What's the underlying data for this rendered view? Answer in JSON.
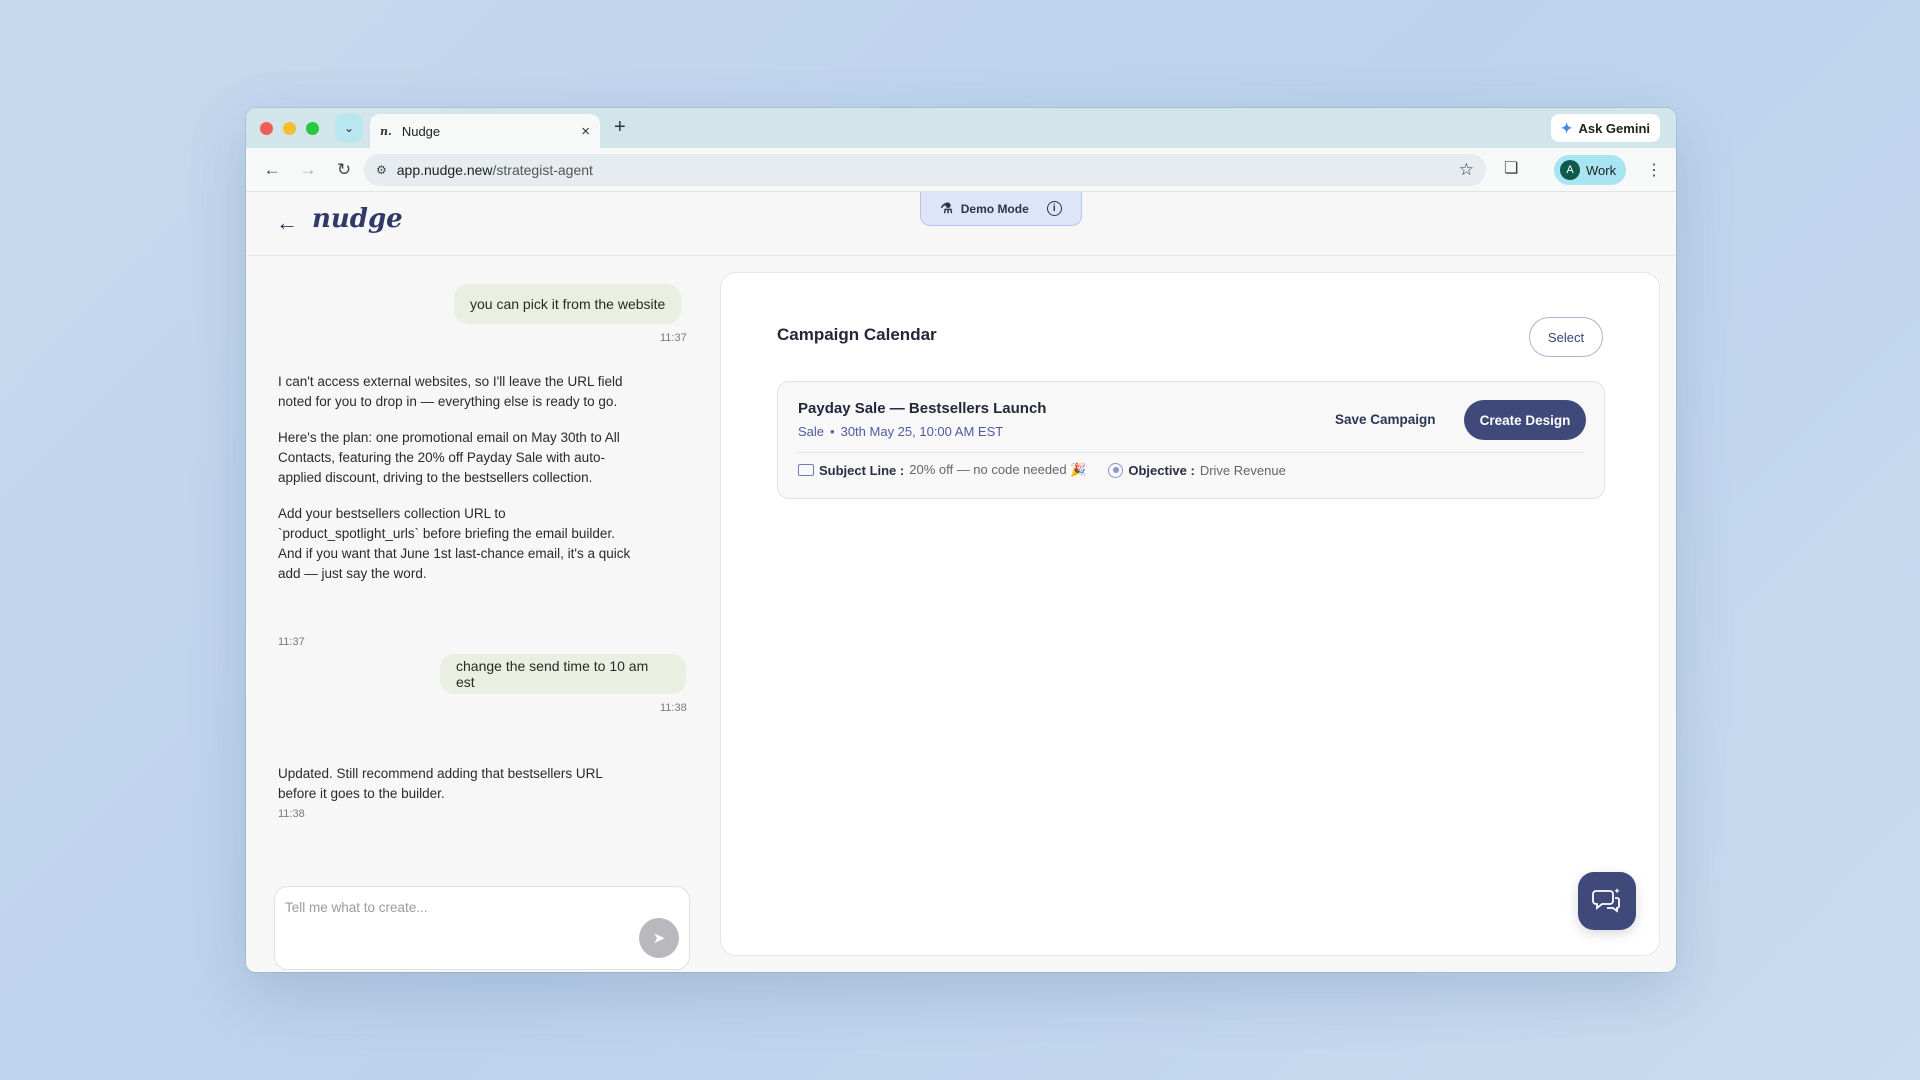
{
  "browser": {
    "tab_title": "Nudge",
    "tab_favicon": "n.",
    "tab_close": "×",
    "new_tab": "+",
    "ask_gemini": "Ask Gemini",
    "url_host": "app.nudge.new",
    "url_path": "/strategist-agent",
    "profile_initial": "A",
    "profile_label": "Work"
  },
  "app": {
    "logo": "nudge",
    "demo_label": "Demo Mode",
    "demo_info": "i"
  },
  "chat": {
    "messages": [
      {
        "role": "user",
        "text": "you can pick it from the website",
        "time": "11:37"
      },
      {
        "role": "assistant",
        "paragraphs": [
          "I can't access external websites, so I'll leave the URL field noted for you to drop in — everything else is ready to go.",
          "Here's the plan: one promotional email on May 30th to All Contacts, featuring the 20% off Payday Sale with auto-applied discount, driving to the bestsellers collection.",
          "Add your bestsellers collection URL to `product_spotlight_urls` before briefing the email builder. And if you want that June 1st last-chance email, it's a quick add — just say the word."
        ],
        "time": "11:37"
      },
      {
        "role": "user",
        "text": "change the send time to 10 am est",
        "time": "11:38"
      },
      {
        "role": "assistant",
        "paragraphs": [
          "Updated. Still recommend adding that bestsellers URL before it goes to the builder."
        ],
        "time": "11:38"
      }
    ],
    "composer_placeholder": "Tell me what to create..."
  },
  "panel": {
    "title": "Campaign Calendar",
    "select_label": "Select",
    "campaign": {
      "title": "Payday Sale — Bestsellers Launch",
      "type": "Sale",
      "separator": "•",
      "schedule": "30th May 25, 10:00 AM EST",
      "save_label": "Save Campaign",
      "create_label": "Create Design",
      "subject_label": "Subject Line :",
      "subject_value": "20% off — no code needed 🎉",
      "objective_label": "Objective :",
      "objective_value": "Drive Revenue"
    }
  },
  "colors": {
    "accent": "#3f4a7b",
    "user_bubble": "#e9efe1",
    "meta_text": "#4f5aa0"
  }
}
